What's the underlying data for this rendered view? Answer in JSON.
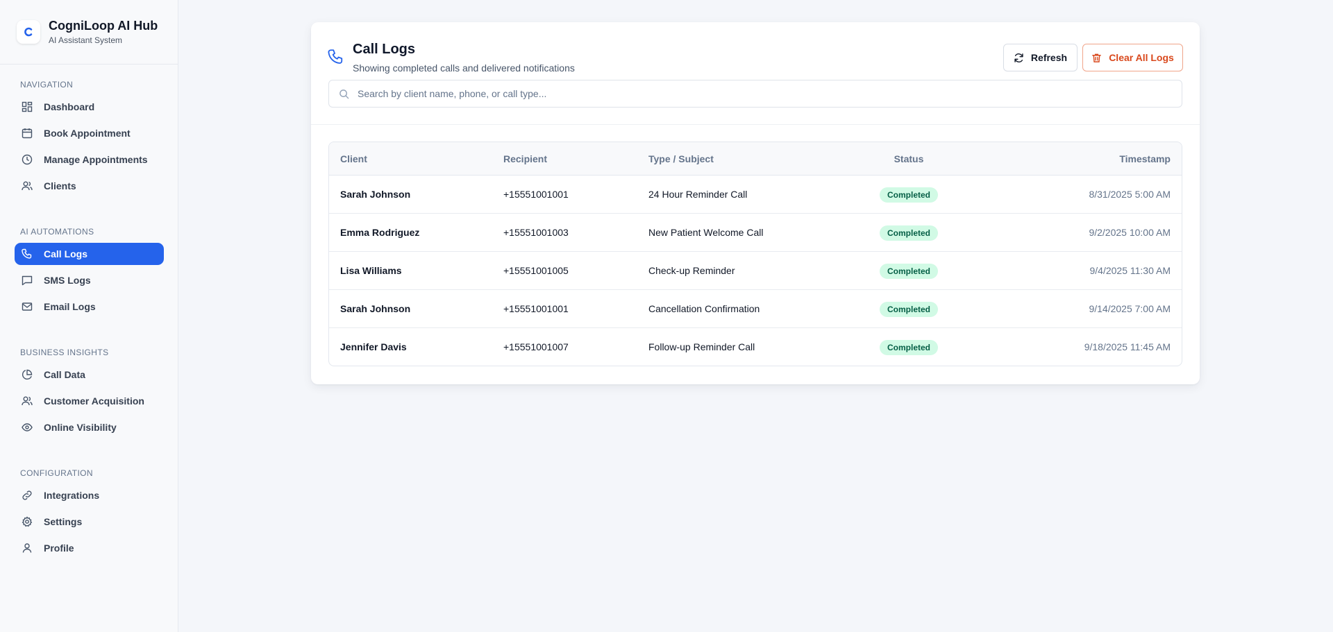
{
  "brand": {
    "title": "CogniLoop AI Hub",
    "subtitle": "AI Assistant System",
    "logo_letter": "c"
  },
  "sidebar": {
    "sections": [
      {
        "heading": "NAVIGATION",
        "items": [
          {
            "label": "Dashboard",
            "icon": "grid-icon"
          },
          {
            "label": "Book Appointment",
            "icon": "calendar-icon"
          },
          {
            "label": "Manage Appointments",
            "icon": "clock-icon"
          },
          {
            "label": "Clients",
            "icon": "users-icon"
          }
        ]
      },
      {
        "heading": "AI AUTOMATIONS",
        "items": [
          {
            "label": "Call Logs",
            "icon": "phone-icon",
            "active": true
          },
          {
            "label": "SMS Logs",
            "icon": "message-icon"
          },
          {
            "label": "Email Logs",
            "icon": "mail-icon"
          }
        ]
      },
      {
        "heading": "BUSINESS INSIGHTS",
        "items": [
          {
            "label": "Call Data",
            "icon": "pie-chart-icon"
          },
          {
            "label": "Customer Acquisition",
            "icon": "users-icon"
          },
          {
            "label": "Online Visibility",
            "icon": "eye-icon"
          }
        ]
      },
      {
        "heading": "CONFIGURATION",
        "items": [
          {
            "label": "Integrations",
            "icon": "link-icon"
          },
          {
            "label": "Settings",
            "icon": "gear-icon"
          },
          {
            "label": "Profile",
            "icon": "user-icon"
          }
        ]
      }
    ]
  },
  "page": {
    "title": "Call Logs",
    "subtitle": "Showing completed calls and delivered notifications",
    "refresh_label": "Refresh",
    "clear_label": "Clear All Logs",
    "search_placeholder": "Search by client name, phone, or call type..."
  },
  "table": {
    "columns": [
      "Client",
      "Recipient",
      "Type / Subject",
      "Status",
      "Timestamp"
    ],
    "rows": [
      {
        "client": "Sarah Johnson",
        "recipient": "+15551001001",
        "type": "24 Hour Reminder Call",
        "status": "Completed",
        "timestamp": "8/31/2025 5:00 AM"
      },
      {
        "client": "Emma Rodriguez",
        "recipient": "+15551001003",
        "type": "New Patient Welcome Call",
        "status": "Completed",
        "timestamp": "9/2/2025 10:00 AM"
      },
      {
        "client": "Lisa Williams",
        "recipient": "+15551001005",
        "type": "Check-up Reminder",
        "status": "Completed",
        "timestamp": "9/4/2025 11:30 AM"
      },
      {
        "client": "Sarah Johnson",
        "recipient": "+15551001001",
        "type": "Cancellation Confirmation",
        "status": "Completed",
        "timestamp": "9/14/2025 7:00 AM"
      },
      {
        "client": "Jennifer Davis",
        "recipient": "+15551001007",
        "type": "Follow-up Reminder Call",
        "status": "Completed",
        "timestamp": "9/18/2025 11:45 AM"
      }
    ]
  },
  "colors": {
    "accent": "#2563eb",
    "danger": "#d9481c",
    "badge_bg": "#d1fae5",
    "badge_text": "#065f46"
  }
}
